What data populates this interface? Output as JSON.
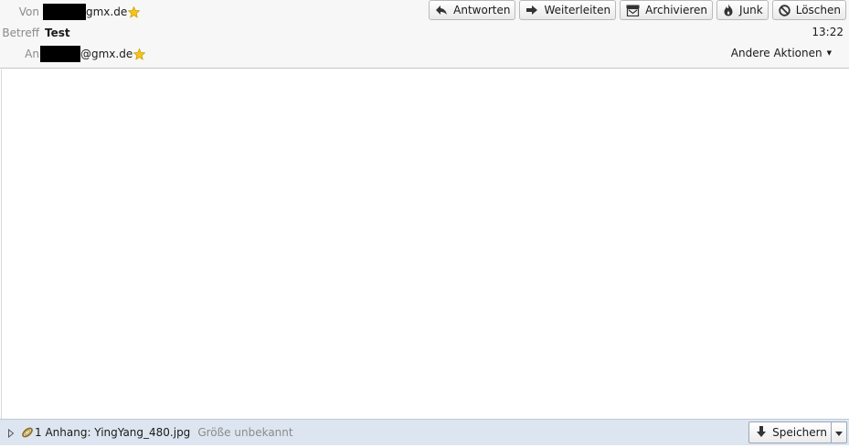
{
  "header": {
    "from_label": "Von",
    "from_address": "gmx.de",
    "subject_label": "Betreff",
    "subject": "Test",
    "to_label": "An",
    "to_address": "@gmx.de",
    "time": "13:22",
    "other_actions": "Andere Aktionen"
  },
  "toolbar": {
    "reply": "Antworten",
    "forward": "Weiterleiten",
    "archive": "Archivieren",
    "junk": "Junk",
    "delete": "Löschen"
  },
  "attachments": {
    "summary": "1 Anhang: YingYang_480.jpg",
    "size": "Größe unbekannt",
    "save": "Speichern"
  },
  "colors": {
    "header_bg": "#f7f7f7",
    "attach_bar_bg": "#dde6f0",
    "star": "#f5c518"
  }
}
